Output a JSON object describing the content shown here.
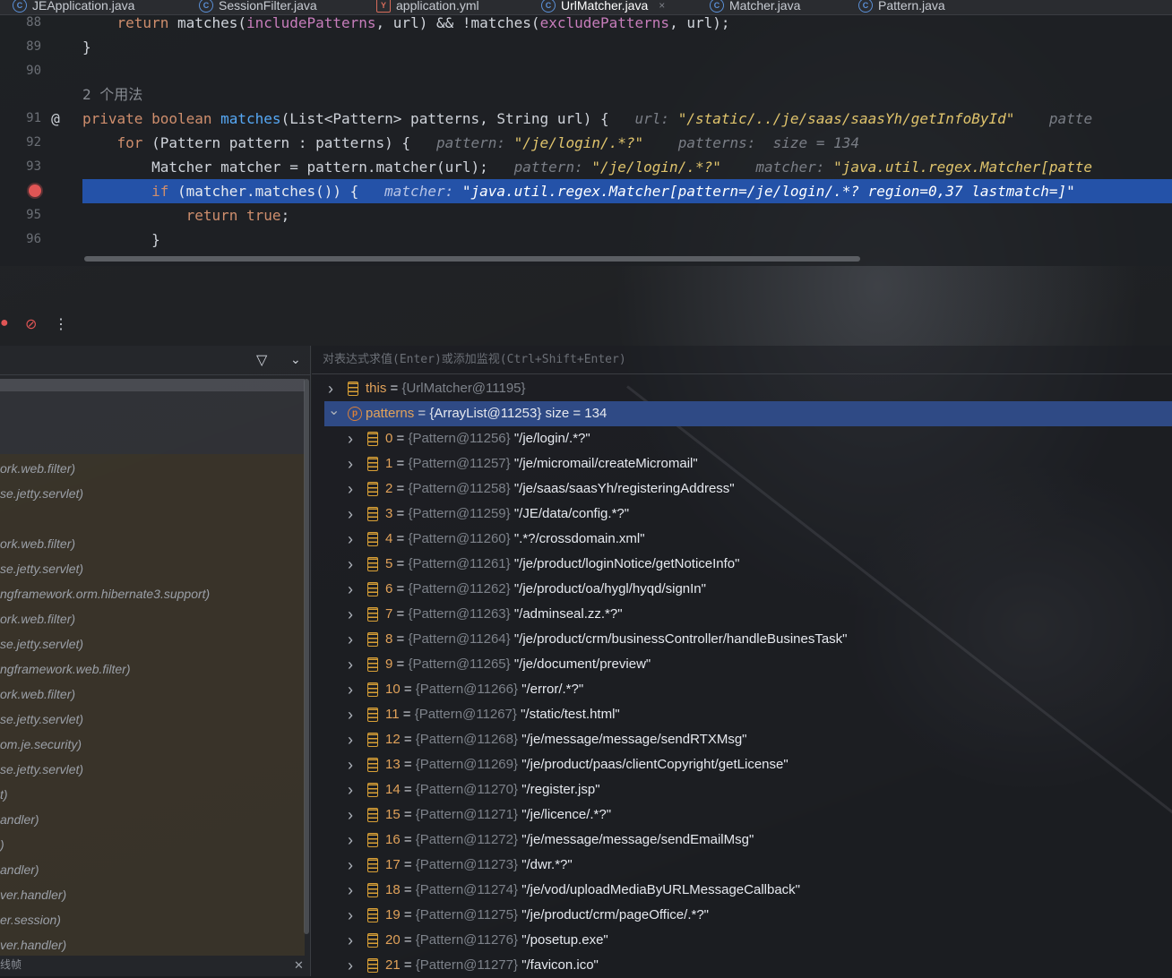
{
  "tabs": [
    {
      "label": "JEApplication.java",
      "icon": "class-icon"
    },
    {
      "label": "SessionFilter.java",
      "icon": "class-icon"
    },
    {
      "label": "application.yml",
      "icon": "yaml-icon"
    },
    {
      "label": "UrlMatcher.java",
      "icon": "class-icon",
      "active": true
    },
    {
      "label": "Matcher.java",
      "icon": "class-icon"
    },
    {
      "label": "Pattern.java",
      "icon": "class-icon"
    }
  ],
  "editor": {
    "lines": [
      {
        "num": "88",
        "parts": [
          [
            "kw",
            "    return "
          ],
          [
            "",
            "matches("
          ],
          [
            "fld",
            "includePatterns"
          ],
          [
            "",
            ", url) && !matches("
          ],
          [
            "fld",
            "excludePatterns"
          ],
          [
            "",
            ", url);"
          ]
        ]
      },
      {
        "num": "89",
        "parts": [
          [
            "",
            "}"
          ]
        ]
      },
      {
        "num": "90",
        "parts": []
      },
      {
        "num": "",
        "parts": [
          [
            "gray",
            "2 个用法"
          ]
        ]
      },
      {
        "num": "91",
        "gutter": "@",
        "parts": [
          [
            "kw",
            "private boolean "
          ],
          [
            "fn",
            "matches"
          ],
          [
            "",
            "(List<Pattern> patterns, String url) {   "
          ],
          [
            "hint",
            "url: "
          ],
          [
            "hintv",
            "\"/static/../je/saas/saasYh/getInfoById\""
          ],
          [
            "hint",
            "    patte"
          ]
        ]
      },
      {
        "num": "92",
        "parts": [
          [
            "kw",
            "    for "
          ],
          [
            "",
            "(Pattern pattern : patterns) {   "
          ],
          [
            "hint",
            "pattern: "
          ],
          [
            "hintv",
            "\"/je/login/.*?\""
          ],
          [
            "hint",
            "    patterns:  size = 134"
          ]
        ]
      },
      {
        "num": "93",
        "parts": [
          [
            "",
            "        Matcher matcher = pattern.matcher(url);   "
          ],
          [
            "hint",
            "pattern: "
          ],
          [
            "hintv",
            "\"/je/login/.*?\""
          ],
          [
            "hint",
            "    matcher: "
          ],
          [
            "hintv",
            "\"java.util.regex.Matcher[patte"
          ]
        ]
      },
      {
        "num": "",
        "breakpoint": true,
        "highlight": true,
        "parts": [
          [
            "kw",
            "        if "
          ],
          [
            "",
            "(matcher.matches()) {   "
          ],
          [
            "hint",
            "matcher: "
          ],
          [
            "hintv",
            "\"java.util.regex.Matcher[pattern=/je/login/.*? region=0,37 lastmatch=]\""
          ]
        ]
      },
      {
        "num": "95",
        "parts": [
          [
            "kw",
            "            return true"
          ],
          [
            "",
            ";"
          ]
        ]
      },
      {
        "num": "96",
        "parts": [
          [
            "",
            "        }"
          ]
        ]
      }
    ]
  },
  "eval_placeholder": "对表达式求值(Enter)或添加监视(Ctrl+Shift+Enter)",
  "frames": [
    "ork.web.filter)",
    "se.jetty.servlet)",
    "",
    "ork.web.filter)",
    "se.jetty.servlet)",
    "ngframework.orm.hibernate3.support)",
    "ork.web.filter)",
    "se.jetty.servlet)",
    "ngframework.web.filter)",
    "ork.web.filter)",
    "se.jetty.servlet)",
    "om.je.security)",
    "se.jetty.servlet)",
    "t)",
    "andler)",
    ")",
    "andler)",
    "ver.handler)",
    "er.session)",
    "ver.handler)"
  ],
  "frames_footer": "线帧",
  "variables": {
    "this": {
      "name": "this",
      "ref": "{UrlMatcher@11195}"
    },
    "patterns": {
      "name": "patterns",
      "ref": "{ArrayList@11253}",
      "size": "size = 134"
    },
    "items": [
      {
        "idx": "0",
        "ref": "{Pattern@11256}",
        "val": "\"/je/login/.*?\""
      },
      {
        "idx": "1",
        "ref": "{Pattern@11257}",
        "val": "\"/je/micromail/createMicromail\""
      },
      {
        "idx": "2",
        "ref": "{Pattern@11258}",
        "val": "\"/je/saas/saasYh/registeringAddress\""
      },
      {
        "idx": "3",
        "ref": "{Pattern@11259}",
        "val": "\"/JE/data/config.*?\""
      },
      {
        "idx": "4",
        "ref": "{Pattern@11260}",
        "val": "\".*?/crossdomain.xml\""
      },
      {
        "idx": "5",
        "ref": "{Pattern@11261}",
        "val": "\"/je/product/loginNotice/getNoticeInfo\""
      },
      {
        "idx": "6",
        "ref": "{Pattern@11262}",
        "val": "\"/je/product/oa/hygl/hyqd/signIn\""
      },
      {
        "idx": "7",
        "ref": "{Pattern@11263}",
        "val": "\"/adminseal.zz.*?\""
      },
      {
        "idx": "8",
        "ref": "{Pattern@11264}",
        "val": "\"/je/product/crm/businessController/handleBusinesTask\""
      },
      {
        "idx": "9",
        "ref": "{Pattern@11265}",
        "val": "\"/je/document/preview\""
      },
      {
        "idx": "10",
        "ref": "{Pattern@11266}",
        "val": "\"/error/.*?\""
      },
      {
        "idx": "11",
        "ref": "{Pattern@11267}",
        "val": "\"/static/test.html\""
      },
      {
        "idx": "12",
        "ref": "{Pattern@11268}",
        "val": "\"/je/message/message/sendRTXMsg\""
      },
      {
        "idx": "13",
        "ref": "{Pattern@11269}",
        "val": "\"/je/product/paas/clientCopyright/getLicense\""
      },
      {
        "idx": "14",
        "ref": "{Pattern@11270}",
        "val": "\"/register.jsp\""
      },
      {
        "idx": "15",
        "ref": "{Pattern@11271}",
        "val": "\"/je/licence/.*?\""
      },
      {
        "idx": "16",
        "ref": "{Pattern@11272}",
        "val": "\"/je/message/message/sendEmailMsg\""
      },
      {
        "idx": "17",
        "ref": "{Pattern@11273}",
        "val": "\"/dwr.*?\""
      },
      {
        "idx": "18",
        "ref": "{Pattern@11274}",
        "val": "\"/je/vod/uploadMediaByURLMessageCallback\""
      },
      {
        "idx": "19",
        "ref": "{Pattern@11275}",
        "val": "\"/je/product/crm/pageOffice/.*?\""
      },
      {
        "idx": "20",
        "ref": "{Pattern@11276}",
        "val": "\"/posetup.exe\""
      },
      {
        "idx": "21",
        "ref": "{Pattern@11277}",
        "val": "\"/favicon.ico\""
      }
    ]
  },
  "colors": {
    "highlight": "#2452a8",
    "breakpoint": "#e05555",
    "keyword": "#cf8e6d",
    "field": "#c77dbb"
  }
}
